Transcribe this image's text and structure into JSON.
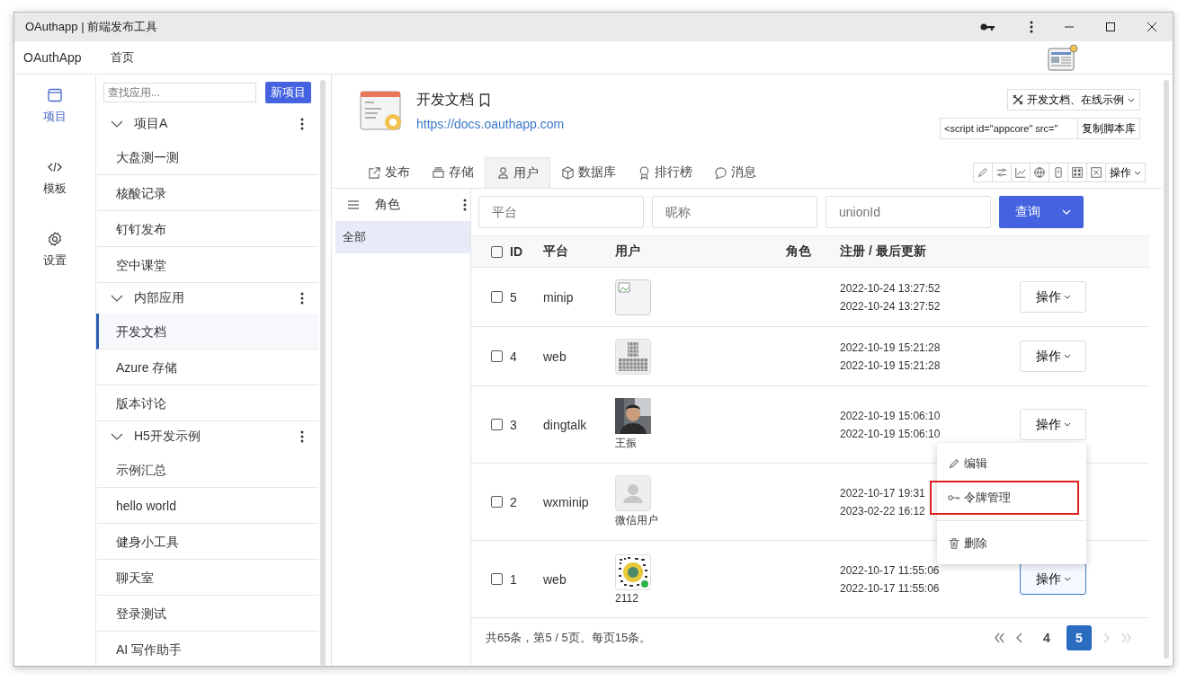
{
  "window": {
    "title": "OAuthapp | 前端发布工具"
  },
  "menu_bar": {
    "brand": "OAuthApp",
    "items": [
      "首页"
    ]
  },
  "nav_rail": [
    {
      "kind": "project",
      "label": "项目",
      "selected": true
    },
    {
      "kind": "code",
      "label": "模板",
      "selected": false
    },
    {
      "kind": "settings",
      "label": "设置",
      "selected": false
    }
  ],
  "app_list": {
    "search_placeholder": "查找应用...",
    "new_button": "新项目",
    "groups": [
      {
        "label": "项目A",
        "expanded": true,
        "children": [
          {
            "label": "大盘测一测",
            "selected": false
          },
          {
            "label": "核酸记录",
            "selected": false
          },
          {
            "label": "钉钉发布",
            "selected": false
          },
          {
            "label": "空中课堂",
            "selected": false
          }
        ]
      },
      {
        "label": "内部应用",
        "expanded": true,
        "children": [
          {
            "label": "开发文档",
            "selected": true
          },
          {
            "label": "Azure 存储",
            "selected": false
          },
          {
            "label": "版本讨论",
            "selected": false
          }
        ]
      },
      {
        "label": "H5开发示例",
        "expanded": true,
        "children": [
          {
            "label": "示例汇总",
            "selected": false
          },
          {
            "label": "hello world",
            "selected": false
          },
          {
            "label": "健身小工具",
            "selected": false
          },
          {
            "label": "聊天室",
            "selected": false
          },
          {
            "label": "登录测试",
            "selected": false
          },
          {
            "label": "AI 写作助手",
            "selected": false
          }
        ]
      }
    ]
  },
  "app_header": {
    "title": "开发文档",
    "url": "https://docs.oauthapp.com",
    "docs_button": "开发文档、在线示例",
    "script_field": "<script id=\"appcore\" src=\"",
    "copy_button": "复制脚本库"
  },
  "tabs": [
    {
      "kind": "publish",
      "label": "发布",
      "selected": false
    },
    {
      "kind": "storage",
      "label": "存储",
      "selected": false
    },
    {
      "kind": "user",
      "label": "用户",
      "selected": true
    },
    {
      "kind": "database",
      "label": "数据库",
      "selected": false
    },
    {
      "kind": "rank",
      "label": "排行榜",
      "selected": false
    },
    {
      "kind": "message",
      "label": "消息",
      "selected": false
    }
  ],
  "toolbar": {
    "action_button": "操作"
  },
  "roles": {
    "title": "角色",
    "items": [
      {
        "label": "全部",
        "selected": true
      }
    ]
  },
  "filters": [
    {
      "placeholder": "平台"
    },
    {
      "placeholder": "昵称"
    },
    {
      "placeholder": "unionId"
    }
  ],
  "query_button": "查询",
  "table": {
    "all_checked": false,
    "columns": [
      "ID",
      "平台",
      "用户",
      "角色",
      "注册 / 最后更新"
    ],
    "rows": [
      {
        "id": "5",
        "checked": false,
        "platform": "minip",
        "kind": "broken",
        "registered": "2022-10-24 13:27:52",
        "updated": "2022-10-24 13:27:52",
        "action": "操作",
        "focused": false,
        "menu_open": false
      },
      {
        "id": "4",
        "checked": false,
        "platform": "web",
        "kind": "pixel",
        "registered": "2022-10-19 15:21:28",
        "updated": "2022-10-19 15:21:28",
        "action": "操作",
        "focused": false,
        "menu_open": false
      },
      {
        "id": "3",
        "checked": false,
        "platform": "dingtalk",
        "user_name": "王振",
        "registered": "2022-10-19 15:06:10",
        "updated": "2022-10-19 15:06:10",
        "action": "操作",
        "focused": false,
        "menu_open": true
      },
      {
        "id": "2",
        "checked": false,
        "platform": "wxminip",
        "kind": "default",
        "user_name": "微信用户",
        "registered": "2022-10-17 19:31",
        "updated": "2023-02-22 16:12",
        "menu_open": false
      },
      {
        "id": "1",
        "checked": false,
        "platform": "web",
        "kind": "qr",
        "user_name": "2112",
        "registered": "2022-10-17 11:55:06",
        "updated": "2022-10-17 11:55:06",
        "action": "操作",
        "focused": true,
        "menu_open": false
      }
    ]
  },
  "row_menu": {
    "items": [
      {
        "kind": "edit",
        "label": "编辑",
        "highlighted": false
      },
      {
        "kind": "token",
        "label": "令牌管理",
        "highlighted": true
      },
      {
        "kind": "delete",
        "label": "删除",
        "highlighted": false
      }
    ]
  },
  "footer": {
    "summary": "共65条，第5 / 5页。每页15条。",
    "nav": [
      {
        "kind": "first",
        "disabled": false
      },
      {
        "kind": "prev",
        "disabled": false
      }
    ],
    "pages": [
      {
        "label": "4",
        "selected": false
      },
      {
        "label": "5",
        "selected": true
      }
    ],
    "nav_after": [
      {
        "kind": "next",
        "disabled": true
      },
      {
        "kind": "last",
        "disabled": true
      }
    ]
  }
}
